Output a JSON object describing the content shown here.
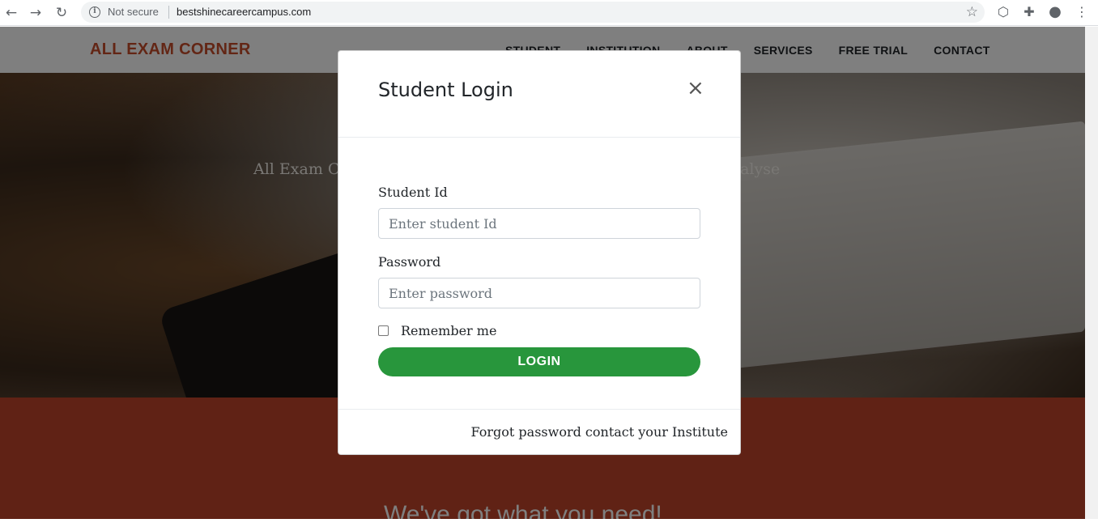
{
  "browser": {
    "security_label": "Not secure",
    "url": "bestshinecareercampus.com"
  },
  "site": {
    "brand": "ALL EXAM CORNER",
    "nav_items": [
      "STUDENT",
      "INSTITUTION",
      "ABOUT",
      "SERVICES",
      "FREE TRIAL",
      "CONTACT"
    ],
    "hero_tagline": "All Exam Co                                                                     tem analyse",
    "section_heading": "We've got what you need!"
  },
  "modal": {
    "title": "Student Login",
    "close_label": "×",
    "student_id_label": "Student Id",
    "student_id_placeholder": "Enter student Id",
    "password_label": "Password",
    "password_placeholder": "Enter password",
    "remember_label": "Remember me",
    "login_label": "LOGIN",
    "forgot_text": "Forgot password contact your Institute"
  },
  "colors": {
    "brand": "#c74c2a",
    "login_button": "#28963c",
    "band": "#c0452a"
  }
}
